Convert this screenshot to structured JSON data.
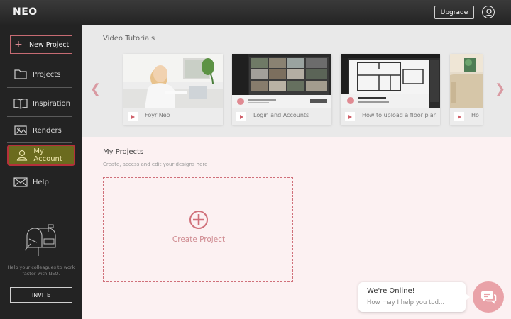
{
  "app": {
    "logo": "NEO"
  },
  "header": {
    "upgrade_label": "Upgrade"
  },
  "sidebar": {
    "new_project_label": "New Project",
    "items": [
      {
        "label": "Projects",
        "icon": "folder-icon"
      },
      {
        "label": "Inspiration",
        "icon": "book-icon"
      },
      {
        "label": "Renders",
        "icon": "image-icon"
      },
      {
        "label": "My Account",
        "icon": "user-icon",
        "active": true
      },
      {
        "label": "Help",
        "icon": "mail-icon"
      }
    ],
    "promo_text": "Help your colleagues to work faster with NEO.",
    "invite_label": "INVITE"
  },
  "tutorials": {
    "title": "Video Tutorials",
    "cards": [
      {
        "title": "Foyr Neo"
      },
      {
        "title": "Login and Accounts"
      },
      {
        "title": "How to upload a floor plan"
      },
      {
        "title": "Ho"
      }
    ]
  },
  "projects": {
    "title": "My Projects",
    "subtitle": "Create, access and edit your designs here",
    "create_label": "Create Project"
  },
  "chat": {
    "line1": "We're Online!",
    "line2": "How may I help you tod..."
  },
  "colors": {
    "accent": "#d0606a",
    "sidebar_bg": "#232323",
    "projects_bg": "#fcf1f2",
    "active_item": "#6b6b1e"
  }
}
